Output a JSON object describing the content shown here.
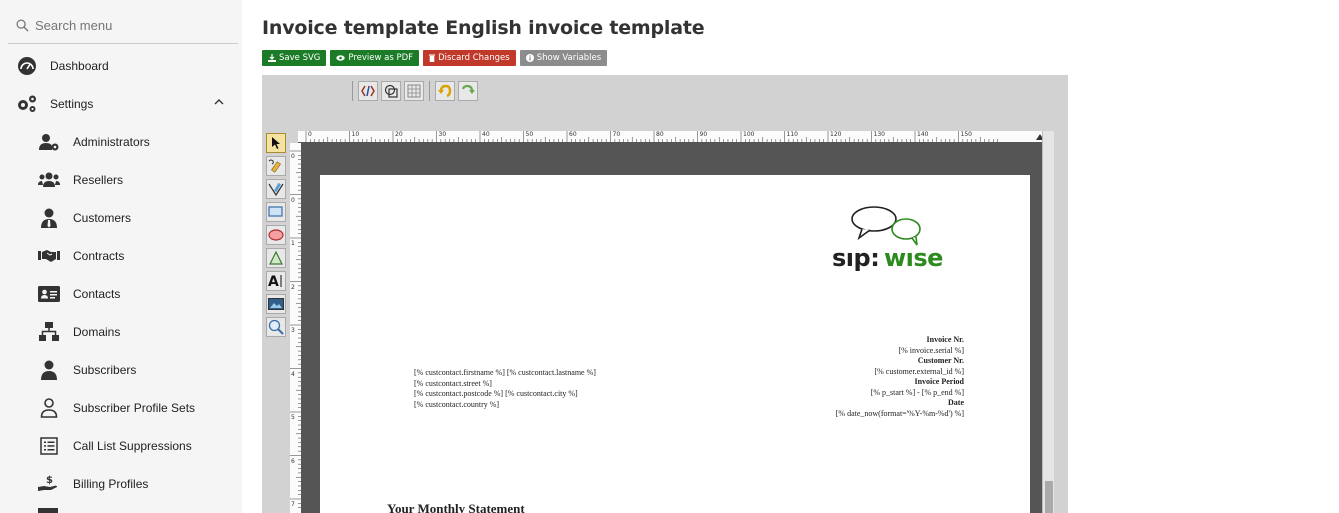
{
  "search": {
    "placeholder": "Search menu"
  },
  "sidebar": {
    "dashboard": "Dashboard",
    "settings": "Settings",
    "items": [
      {
        "label": "Administrators",
        "icon": "user-gear-icon"
      },
      {
        "label": "Resellers",
        "icon": "users-icon"
      },
      {
        "label": "Customers",
        "icon": "user-tie-icon"
      },
      {
        "label": "Contracts",
        "icon": "handshake-icon"
      },
      {
        "label": "Contacts",
        "icon": "address-card-icon"
      },
      {
        "label": "Domains",
        "icon": "network-icon"
      },
      {
        "label": "Subscribers",
        "icon": "user-icon"
      },
      {
        "label": "Subscriber Profile Sets",
        "icon": "user-outline-icon"
      },
      {
        "label": "Call List Suppressions",
        "icon": "list-icon"
      },
      {
        "label": "Billing Profiles",
        "icon": "hand-coin-icon"
      }
    ]
  },
  "page": {
    "title": "Invoice template English invoice template"
  },
  "buttons": {
    "save": "Save SVG",
    "preview": "Preview as PDF",
    "discard": "Discard Changes",
    "variables": "Show Variables"
  },
  "colors": {
    "green": "#1b7b27",
    "red": "#c0392b",
    "grey": "#8c8c8c",
    "logo_green": "#2d8a1f"
  },
  "ruler": {
    "top": [
      "0",
      "10",
      "20",
      "30",
      "40",
      "50",
      "60",
      "70",
      "80",
      "90",
      "100",
      "110",
      "120",
      "130",
      "140",
      "150"
    ],
    "left": [
      "0",
      "0",
      "1",
      "2",
      "3",
      "4",
      "5",
      "6",
      "7"
    ]
  },
  "logo": {
    "text": "sip:wise"
  },
  "invoice": {
    "address": [
      "[% custcontact.firstname %] [% custcontact.lastname %]",
      "[% custcontact.street %]",
      "[% custcontact.postcode %] [% custcontact.city %]",
      "[% custcontact.country %]"
    ],
    "invoice_nr_label": "Invoice Nr.",
    "invoice_nr_value": "[% invoice.serial %]",
    "customer_nr_label": "Customer Nr.",
    "customer_nr_value": "[% customer.external_id %]",
    "period_label": "Invoice Period",
    "period_value": "[% p_start %] - [% p_end %]",
    "date_label": "Date",
    "date_value": "[% date_now(format='%Y-%m-%d') %]",
    "statement": "Your Monthly Statement"
  }
}
